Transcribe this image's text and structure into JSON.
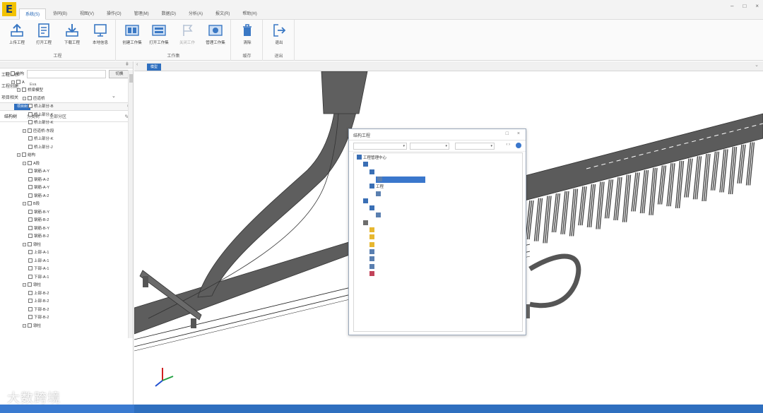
{
  "app": {
    "logo_letter": "E",
    "window_title": "",
    "window_controls": [
      "–",
      "□",
      "×"
    ]
  },
  "menu": {
    "tabs": [
      "系统(S)",
      "协同(B)",
      "视图(V)",
      "操作(O)",
      "管理(M)",
      "数据(D)",
      "分析(A)",
      "报文(R)",
      "帮助(H)"
    ]
  },
  "ribbon": {
    "groups": [
      {
        "label": "工程",
        "buttons": [
          "上传工程",
          "打开工程",
          "下载工程",
          "本地信息"
        ]
      },
      {
        "label": "工作集",
        "buttons": [
          "创建工作集",
          "打开工作集",
          "关闭工作",
          "管理工作集"
        ]
      },
      {
        "label": "缓存",
        "buttons": [
          "清除"
        ]
      },
      {
        "label": "退出",
        "buttons": [
          "退出"
        ]
      }
    ]
  },
  "left_panel": {
    "project_label": "工程名称:",
    "project_value": "",
    "switch_button": "切换",
    "creator_label": "工程创建:",
    "creator_value": "Eva",
    "related_label": "项目相关",
    "panel_tab": "项目树",
    "subtabs": [
      "结构树",
      "分类树",
      "全部分区"
    ],
    "tree": [
      {
        "level": 0,
        "text": "结构"
      },
      {
        "level": 1,
        "text": "A"
      },
      {
        "level": 2,
        "text": "桥梁模型"
      },
      {
        "level": 3,
        "text": "匝道桥"
      },
      {
        "level": 4,
        "text": "桥上部分-B"
      },
      {
        "level": 4,
        "text": "桥上部分-K"
      },
      {
        "level": 4,
        "text": "桥上部分-K"
      },
      {
        "level": 3,
        "text": "匝道桥-东段"
      },
      {
        "level": 4,
        "text": "桥上部分-K"
      },
      {
        "level": 4,
        "text": "桥上部分-J"
      },
      {
        "level": 2,
        "text": "结构"
      },
      {
        "level": 3,
        "text": "A段"
      },
      {
        "level": 4,
        "text": "钢筋-A-Y"
      },
      {
        "level": 4,
        "text": "钢筋-A-2"
      },
      {
        "level": 4,
        "text": "钢筋-A-Y"
      },
      {
        "level": 4,
        "text": "钢筋-A-2"
      },
      {
        "level": 3,
        "text": "B段"
      },
      {
        "level": 4,
        "text": "钢筋-B-Y"
      },
      {
        "level": 4,
        "text": "钢筋-B-2"
      },
      {
        "level": 4,
        "text": "钢筋-B-Y"
      },
      {
        "level": 4,
        "text": "钢筋-B-2"
      },
      {
        "level": 3,
        "text": "墩柱"
      },
      {
        "level": 4,
        "text": "上部-A-1"
      },
      {
        "level": 4,
        "text": "上部-A-1"
      },
      {
        "level": 4,
        "text": "下部-A-1"
      },
      {
        "level": 4,
        "text": "下部-A-1"
      },
      {
        "level": 3,
        "text": "墩柱"
      },
      {
        "level": 4,
        "text": "上部-B-2"
      },
      {
        "level": 4,
        "text": "上部-B-2"
      },
      {
        "level": 4,
        "text": "下部-B-2"
      },
      {
        "level": 4,
        "text": "下部-B-2"
      },
      {
        "level": 3,
        "text": "墩柱"
      }
    ]
  },
  "viewport": {
    "tab": "模型"
  },
  "dialog": {
    "title": "结构工程",
    "filter_1": "",
    "filter_2": "",
    "filter_3": "",
    "tree": [
      {
        "level": 0,
        "text": "工程管理中心",
        "icon": "folder-blue"
      },
      {
        "level": 1,
        "text": "",
        "icon": "folder-blue"
      },
      {
        "level": 2,
        "text": "",
        "icon": "folder-blue"
      },
      {
        "level": 3,
        "text": "",
        "icon": "doc",
        "selected": true
      },
      {
        "level": 2,
        "text": "工程",
        "icon": "folder-blue"
      },
      {
        "level": 3,
        "text": "",
        "icon": "doc"
      },
      {
        "level": 1,
        "text": "",
        "icon": "folder-blue"
      },
      {
        "level": 2,
        "text": "",
        "icon": "folder-blue"
      },
      {
        "level": 3,
        "text": "",
        "icon": "doc"
      },
      {
        "level": 1,
        "text": "",
        "icon": "gear"
      },
      {
        "level": 2,
        "text": "",
        "icon": "folder-yellow"
      },
      {
        "level": 2,
        "text": "",
        "icon": "folder-yellow"
      },
      {
        "level": 2,
        "text": "",
        "icon": "folder-yellow"
      },
      {
        "level": 2,
        "text": "",
        "icon": "doc"
      },
      {
        "level": 2,
        "text": "",
        "icon": "doc"
      },
      {
        "level": 2,
        "text": "",
        "icon": "doc"
      },
      {
        "level": 2,
        "text": "",
        "icon": "doc-red"
      }
    ]
  },
  "status": {
    "right_text": "",
    "version": ""
  },
  "watermark": "大数跨境",
  "colors": {
    "accent": "#2f6fbf",
    "ribbon_icon_blue": "#3a78c4",
    "logo_yellow": "#f2c200",
    "model_gray": "#5d5d5d"
  }
}
